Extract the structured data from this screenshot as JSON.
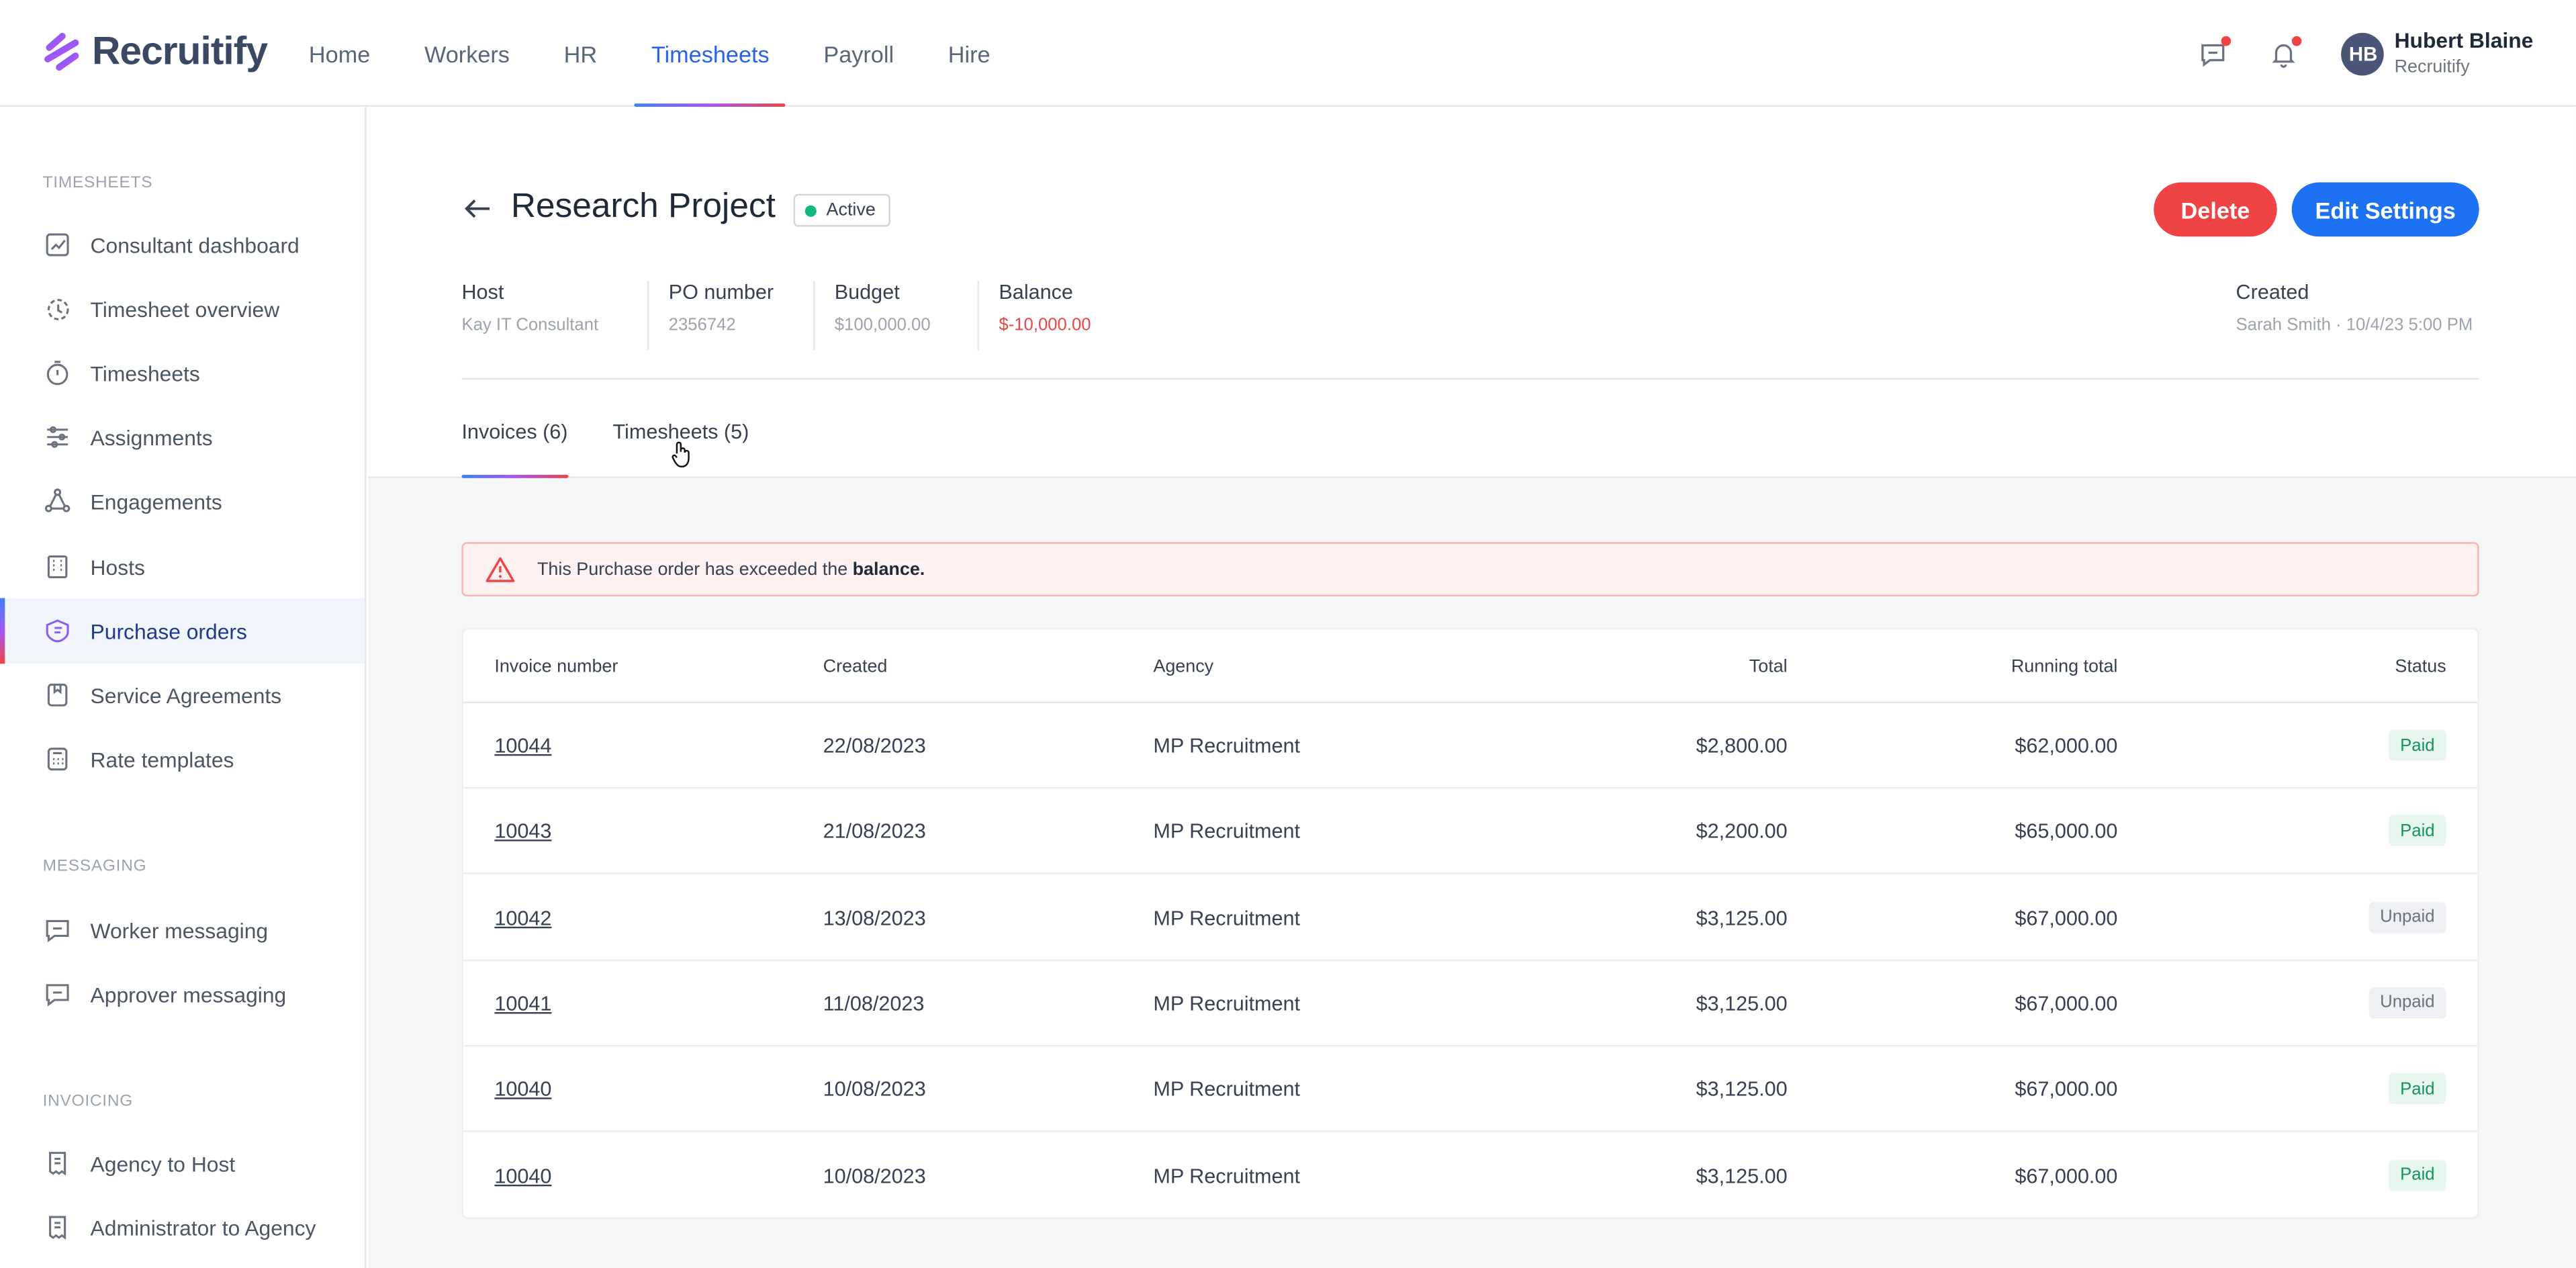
{
  "app": {
    "name": "Recruitify"
  },
  "nav": {
    "items": [
      {
        "label": "Home"
      },
      {
        "label": "Workers"
      },
      {
        "label": "HR"
      },
      {
        "label": "Timesheets",
        "active": true
      },
      {
        "label": "Payroll"
      },
      {
        "label": "Hire"
      }
    ]
  },
  "user": {
    "initials": "HB",
    "name": "Hubert Blaine",
    "org": "Recruitify"
  },
  "sidebar": {
    "sections": [
      {
        "title": "TIMESHEETS",
        "items": [
          {
            "label": "Consultant dashboard",
            "icon": "chart-icon"
          },
          {
            "label": "Timesheet overview",
            "icon": "clock-history-icon"
          },
          {
            "label": "Timesheets",
            "icon": "stopwatch-icon"
          },
          {
            "label": "Assignments",
            "icon": "sliders-icon"
          },
          {
            "label": "Engagements",
            "icon": "nodes-icon"
          },
          {
            "label": "Hosts",
            "icon": "building-icon"
          },
          {
            "label": "Purchase orders",
            "icon": "tag-icon",
            "active": true
          },
          {
            "label": "Service Agreements",
            "icon": "document-icon"
          },
          {
            "label": "Rate templates",
            "icon": "calculator-icon"
          }
        ]
      },
      {
        "title": "MESSAGING",
        "items": [
          {
            "label": "Worker messaging",
            "icon": "message-icon"
          },
          {
            "label": "Approver messaging",
            "icon": "message-icon"
          }
        ]
      },
      {
        "title": "INVOICING",
        "items": [
          {
            "label": "Agency to Host",
            "icon": "receipt-icon"
          },
          {
            "label": "Administrator to Agency",
            "icon": "receipt-icon"
          }
        ]
      }
    ]
  },
  "page": {
    "title": "Research Project",
    "status": "Active",
    "delete_label": "Delete",
    "edit_label": "Edit Settings",
    "meta": {
      "host_label": "Host",
      "host_value": "Kay IT Consultant",
      "po_label": "PO number",
      "po_value": "2356742",
      "budget_label": "Budget",
      "budget_value": "$100,000.00",
      "balance_label": "Balance",
      "balance_value": "$-10,000.00",
      "created_label": "Created",
      "created_value": "Sarah Smith · 10/4/23 5:00 PM"
    },
    "tabs": [
      {
        "label": "Invoices (6)",
        "active": true
      },
      {
        "label": "Timesheets (5)"
      }
    ],
    "alert": {
      "text": "This Purchase order has exceeded the",
      "strong": "balance."
    }
  },
  "table": {
    "headers": {
      "invoice": "Invoice number",
      "created": "Created",
      "agency": "Agency",
      "total": "Total",
      "running": "Running total",
      "status": "Status"
    },
    "rows": [
      {
        "invoice": "10044",
        "created": "22/08/2023",
        "agency": "MP Recruitment",
        "total": "$2,800.00",
        "running": "$62,000.00",
        "status": "Paid"
      },
      {
        "invoice": "10043",
        "created": "21/08/2023",
        "agency": "MP Recruitment",
        "total": "$2,200.00",
        "running": "$65,000.00",
        "status": "Paid"
      },
      {
        "invoice": "10042",
        "created": "13/08/2023",
        "agency": "MP Recruitment",
        "total": "$3,125.00",
        "running": "$67,000.00",
        "status": "Unpaid"
      },
      {
        "invoice": "10041",
        "created": "11/08/2023",
        "agency": "MP Recruitment",
        "total": "$3,125.00",
        "running": "$67,000.00",
        "status": "Unpaid"
      },
      {
        "invoice": "10040",
        "created": "10/08/2023",
        "agency": "MP Recruitment",
        "total": "$3,125.00",
        "running": "$67,000.00",
        "status": "Paid"
      },
      {
        "invoice": "10040",
        "created": "10/08/2023",
        "agency": "MP Recruitment",
        "total": "$3,125.00",
        "running": "$67,000.00",
        "status": "Paid"
      }
    ]
  },
  "colors": {
    "primary": "#1d72f3",
    "danger": "#ef4444",
    "active_dot": "#10b981",
    "paid_bg": "#e7f7ef",
    "paid_text": "#15925a",
    "unpaid_bg": "#eef0f3"
  }
}
